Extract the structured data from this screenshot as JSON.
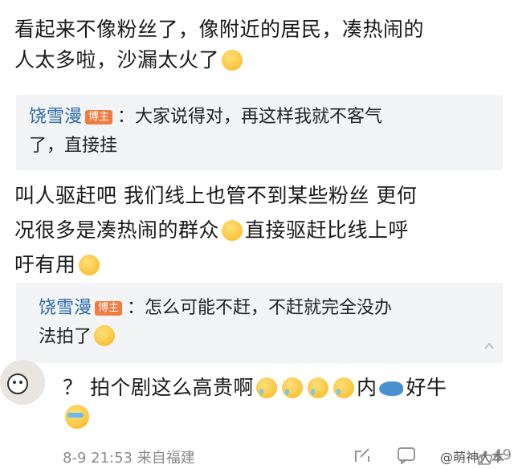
{
  "comment1": {
    "line1": "看起来不像粉丝了，像附近的居民，凑热闹的",
    "line2": "人太多啦，沙漏太火了"
  },
  "reply1": {
    "author": "饶雪漫",
    "badge": "博主",
    "line1": "：大家说得对，再这样我就不客气",
    "line2": "了，直接挂"
  },
  "comment2": {
    "line1": "叫人驱赶吧 我们线上也管不到某些粉丝 更何",
    "line2a": "况很多是凑热闹的群众",
    "line2b": "直接驱赶比线上呼",
    "line3": "吁有用"
  },
  "reply2": {
    "author": "饶雪漫",
    "badge": "博主",
    "line1": "：怎么可能不赶，不赶就完全没办",
    "line2": "法拍了"
  },
  "comment3": {
    "text_a": "？ 拍个剧这么高贵啊",
    "text_b": "内",
    "text_c": "好牛"
  },
  "footer": {
    "meta": "8-9 21:53  来自福建",
    "like_count": "49",
    "watermark": "@萌神大本"
  },
  "icons": [
    "emoji-sunglasses",
    "emoji-laugh-cry",
    "emoji-smile",
    "emoji-pray",
    "emoji-sweat",
    "fish-icon",
    "emoji-cry",
    "share-icon",
    "comment-icon",
    "like-icon"
  ]
}
